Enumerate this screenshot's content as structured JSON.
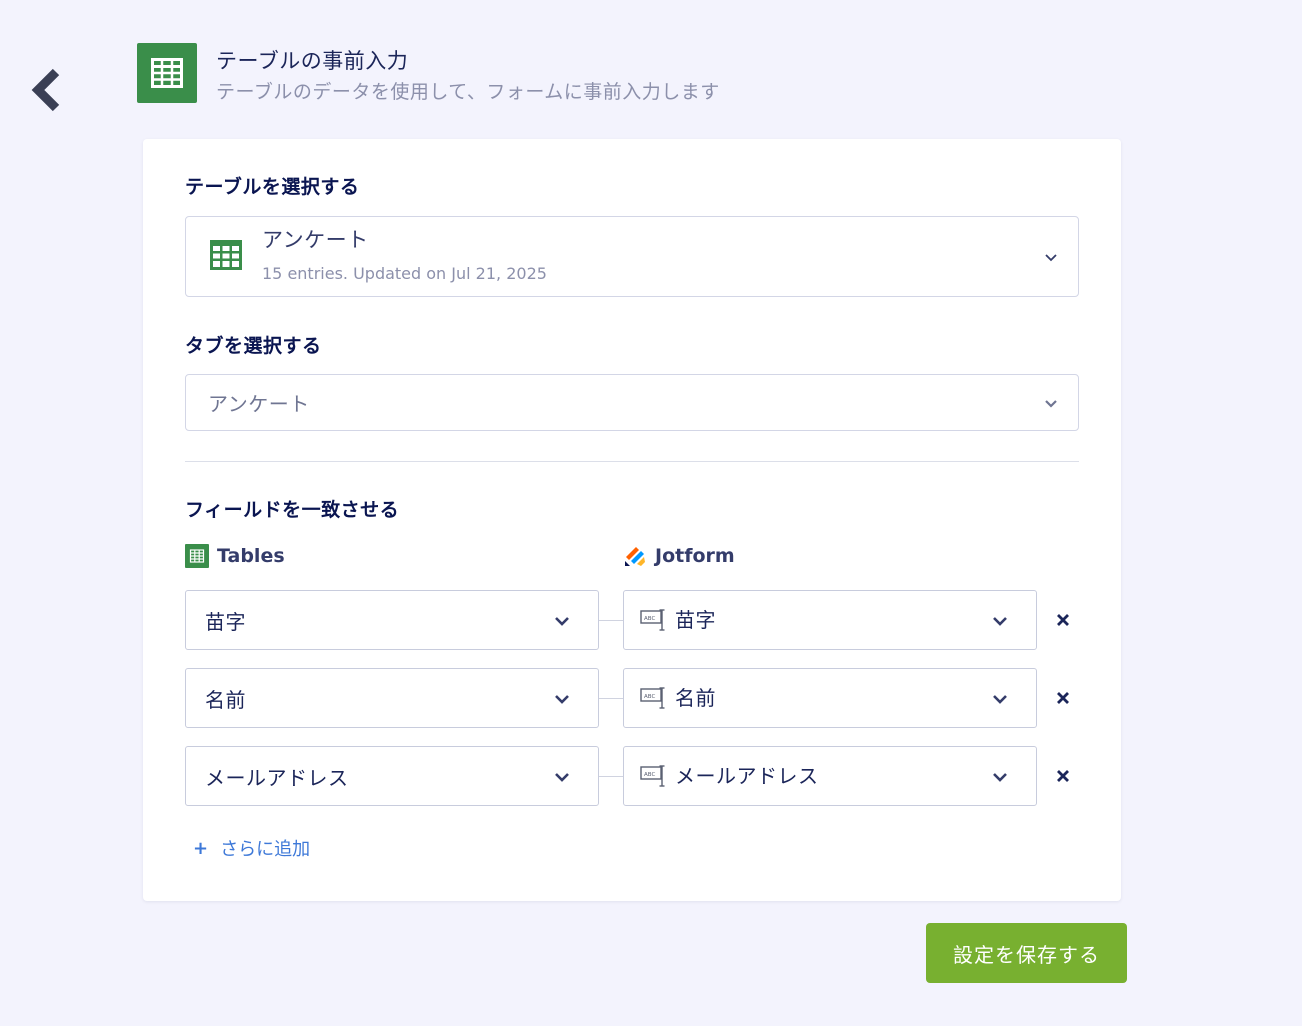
{
  "header": {
    "title": "テーブルの事前入力",
    "subtitle": "テーブルのデータを使用して、フォームに事前入力します",
    "icon": "table-grid-icon",
    "icon_color": "#3a8e4a"
  },
  "back_button": {
    "icon": "chevron-left-icon"
  },
  "table_section": {
    "label": "テーブルを選択する",
    "selected_name": "アンケート",
    "meta": "15 entries. Updated on Jul 21, 2025"
  },
  "tab_section": {
    "label": "タブを選択する",
    "selected": "アンケート"
  },
  "match_section": {
    "label": "フィールドを一致させる",
    "left_header": "Tables",
    "right_header": "Jotform",
    "rows": [
      {
        "table_field": "苗字",
        "form_field": "苗字"
      },
      {
        "table_field": "名前",
        "form_field": "名前"
      },
      {
        "table_field": "メールアドレス",
        "form_field": "メールアドレス"
      }
    ],
    "add_more": "さらに追加"
  },
  "save_button": {
    "label": "設定を保存する",
    "color": "#78b030"
  },
  "colors": {
    "background": "#f3f3fd",
    "link": "#3d78d8",
    "text_dark": "#0a1551"
  }
}
